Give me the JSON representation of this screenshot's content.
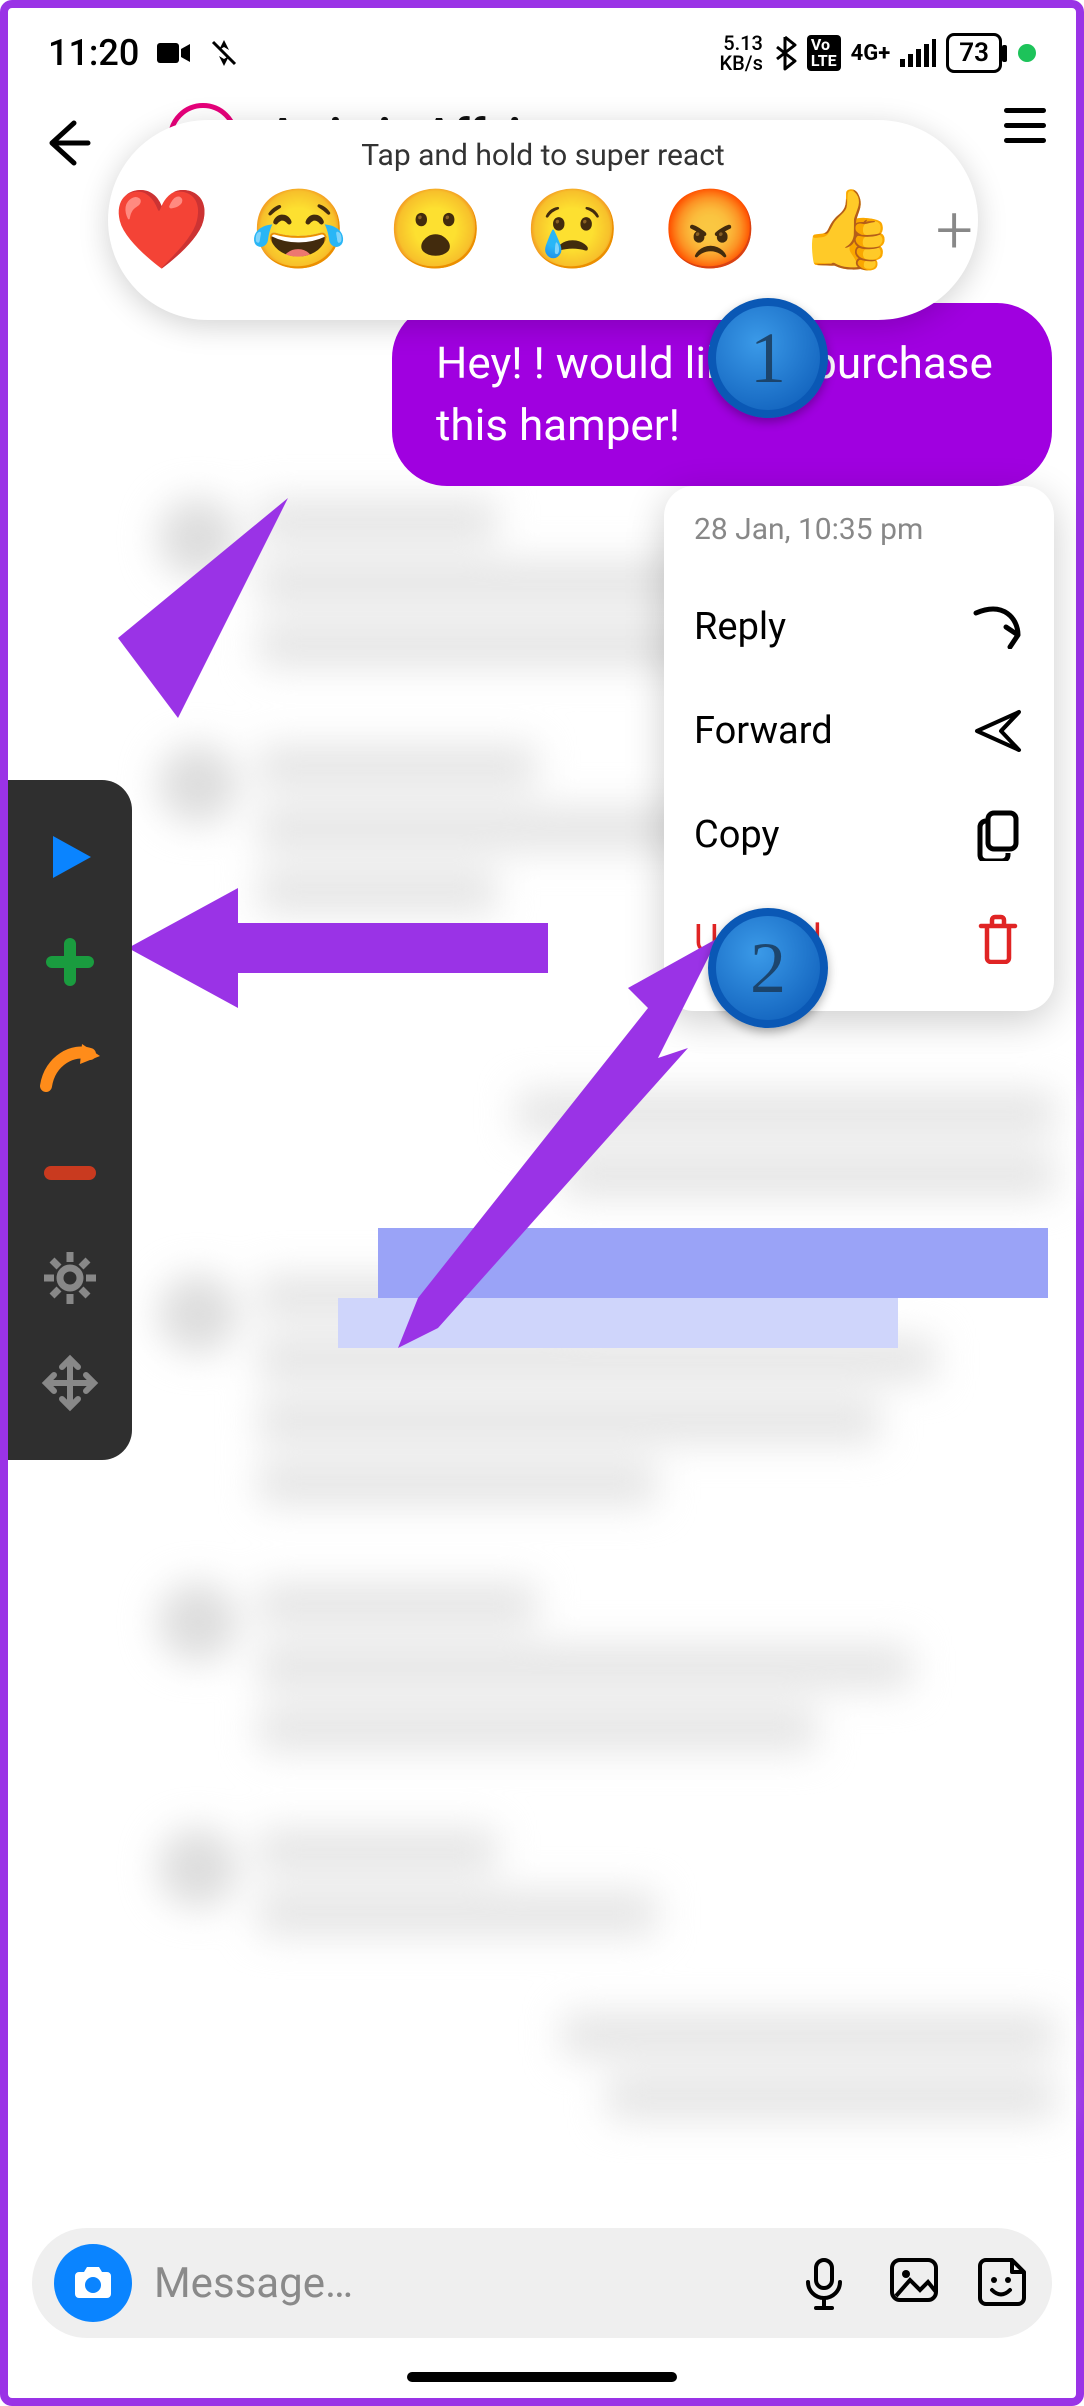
{
  "status": {
    "time": "11:20",
    "kbps_value": "5.13",
    "kbps_unit": "KB/s",
    "signal_label": "4G+",
    "battery": "73"
  },
  "header": {
    "chat_title": "Artistic Affairs"
  },
  "reaction_bar": {
    "hint": "Tap and hold to super react",
    "emojis": [
      "❤️",
      "😂",
      "😮",
      "😢",
      "😡",
      "👍"
    ],
    "add": "+"
  },
  "message": {
    "text": "Hey! ! would like to purchase this hamper!"
  },
  "context_menu": {
    "timestamp": "28 Jan, 10:35 pm",
    "reply": "Reply",
    "forward": "Forward",
    "copy": "Copy",
    "unsend": "Unsend"
  },
  "badges": {
    "one": "1",
    "two": "2"
  },
  "compose": {
    "placeholder": "Message…"
  },
  "side_toolbar": {
    "items": [
      "play-icon",
      "plus-icon",
      "redo-arrow-icon",
      "minus-icon",
      "gear-icon",
      "move-icon"
    ]
  }
}
